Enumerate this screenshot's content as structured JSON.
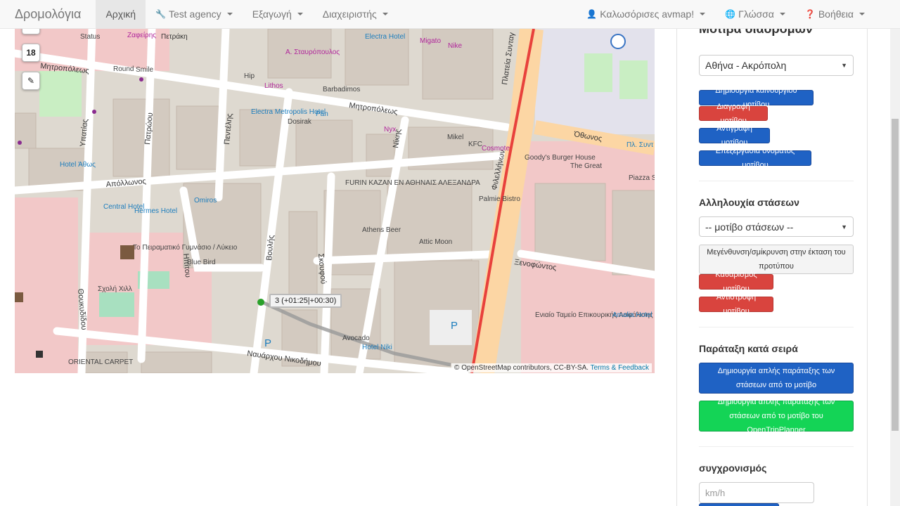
{
  "navbar": {
    "brand": "Δρομολόγια",
    "items": [
      {
        "label": "Αρχική"
      },
      {
        "label": "Test agency"
      },
      {
        "label": "Εξαγωγή"
      },
      {
        "label": "Διαχειριστής"
      }
    ],
    "right": [
      {
        "label": "Καλωσόρισες avmap!"
      },
      {
        "label": "Γλώσσα"
      },
      {
        "label": "Βοήθεια"
      }
    ]
  },
  "map": {
    "zoom_level": "18",
    "tooltip": "3 (+01:25|+00:30)",
    "attribution": "© OpenStreetMap contributors, CC-BY-SA.",
    "attribution_link": "Terms & Feedback",
    "labels": {
      "status": "Status",
      "zafeiris": "Ζαφείρης",
      "petraki": "Πετράκη",
      "mitropoleos_w": "Μητροπόλεως",
      "round": "Round",
      "smile": "Smile",
      "stavropoulos": "Α. Σταυρόπουλος",
      "electra_hotel": "Electra Hotel",
      "migato": "Migato",
      "nike": "Nike",
      "hip": "Hip",
      "lithos": "Lithos",
      "barbadimos": "Barbadimos",
      "mitropoleos_e": "Μητροπόλεως",
      "electra_metropolis": "Electra Metropolis Hotel",
      "pan": "Pan",
      "dosirak": "Dosirak",
      "nyx": "Nyx",
      "mikel": "Mikel",
      "kfc": "KFC",
      "cosmote": "Cosmote",
      "othonos": "Όθωνος",
      "pl_synt": "Πλ. Συντ",
      "goodys": "Goody's Burger House",
      "the_great": "The Great",
      "piazza": "Piazza Syntagm",
      "hotel_athos": "Hotel Άθως",
      "apollonos": "Απόλλωνος",
      "ypatias": "Υπατίας",
      "patroou": "Πατρώου",
      "pentelis": "Πεντέλης",
      "nikis": "Νίκης",
      "filellinon": "Φιλελλήνων",
      "plateia": "Πλατεία Συνταγ",
      "central_hotel": "Central Hotel",
      "hermes_hotel": "Hermes Hotel",
      "omiros": "Omiros",
      "furin": "FURIN KAZAN ΕΝ ΑΘΗΝΑΙΣ ΑΛΕΞΑΝΔΡΑ",
      "palmie": "Palmie Bistro",
      "athens_beer": "Athens Beer",
      "attic_moon": "Attic Moon",
      "voulis": "Βουλής",
      "ipitou": "Ηπίτου",
      "skoufou": "Σκουφού",
      "xenofontos": "Ξενοφώντος",
      "gymnasio": "Το Πειραματικό Γυμνάσιο / Λύκειο",
      "blue_bird": "Blue Bird",
      "thoukididou": "Θουκυδίδου",
      "scholi": "Σχολή Χιλλ",
      "eniaio": "Ενιαίο Ταμείο Επικουρικής Ασφάλισης",
      "amalia": "Amalia Hotel",
      "avocado": "Avocado",
      "hotel_niki": "Hotel Niki",
      "oriental": "ORIENTAL CARPET",
      "navarchou": "Ναυάρχου Νικοδήμου",
      "p1": "P",
      "p2": "P"
    }
  },
  "sidebar": {
    "title_cut": "Μοτίβα διαδρομών",
    "pattern_select": "Αθήνα - Ακρόπολη",
    "btn_create": "Δημιουργία καινούργιου μοτίβου",
    "btn_delete": "Διαγραφή μοτίβου",
    "btn_copy": "Αντιγραφή μοτίβου",
    "btn_rename": "Επεξεργασία ονόματος μοτίβου",
    "stops_title": "Αλληλουχία στάσεων",
    "stops_select": "-- μοτίβο στάσεων --",
    "btn_zoom": "Μεγένθυνση/σμίκρυνση στην έκταση του προτύπου",
    "btn_clear": "Καθαρισμός μοτίβου",
    "btn_reverse": "Αντιστροφή μοτίβου",
    "order_title": "Παράταξη κατά σειρά",
    "btn_auto": "Δημιουργία απλής παράταξης των στάσεων από το μοτίβο",
    "btn_otp": "Δημιουργία απλής παράταξης των στάσεων από το μοτίβο του OpenTripPlanner",
    "sync_title": "συγχρονισμός",
    "speed_placeholder": "km/h"
  },
  "colors": {
    "primary": "#1f62c4",
    "danger": "#d9443e",
    "success": "#14d456",
    "map_bg": "#ded9d0",
    "road": "#ffffff",
    "main_road": "#fcd6a4",
    "rail": "#e8413c"
  }
}
